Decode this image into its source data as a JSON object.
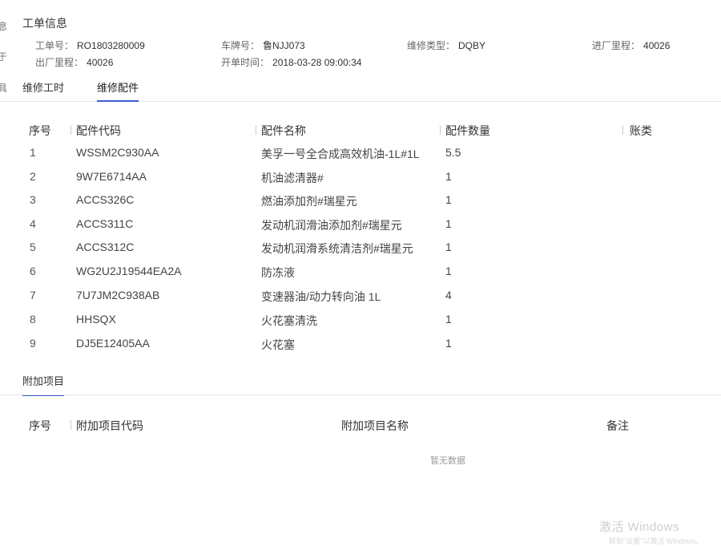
{
  "edge_glyphs": [
    "息",
    "于",
    "具"
  ],
  "info": {
    "section_title": "工单信息",
    "fields": [
      {
        "label": "工单号：",
        "value": "RO1803280009"
      },
      {
        "label": "车牌号：",
        "value": "鲁NJJ073"
      },
      {
        "label": "维修类型：",
        "value": "DQBY"
      },
      {
        "label": "进厂里程：",
        "value": "40026"
      },
      {
        "label": "出厂里程：",
        "value": "40026"
      },
      {
        "label": "开单时间：",
        "value": "2018-03-28 09:00:34"
      }
    ]
  },
  "tabs": [
    {
      "label": "维修工时",
      "active": false
    },
    {
      "label": "维修配件",
      "active": true
    }
  ],
  "parts_table": {
    "columns": [
      "序号",
      "配件代码",
      "配件名称",
      "配件数量",
      "账类"
    ],
    "rows": [
      [
        "1",
        "WSSM2C930AA",
        "美孚一号全合成高效机油-1L#1L",
        "5.5"
      ],
      [
        "2",
        "9W7E6714AA",
        "机油滤清器#",
        "1"
      ],
      [
        "3",
        "ACCS326C",
        "燃油添加剂#瑞星元",
        "1"
      ],
      [
        "4",
        "ACCS311C",
        "发动机润滑油添加剂#瑞星元",
        "1"
      ],
      [
        "5",
        "ACCS312C",
        "发动机润滑系统清洁剂#瑞星元",
        "1"
      ],
      [
        "6",
        "WG2U2J19544EA2A",
        "防冻液",
        "1"
      ],
      [
        "7",
        "7U7JM2C938AB",
        "变速器油/动力转向油 1L",
        "4"
      ],
      [
        "8",
        "HHSQX",
        "火花塞清洗",
        "1"
      ],
      [
        "9",
        "DJ5E12405AA",
        "火花塞",
        "1"
      ]
    ]
  },
  "extra": {
    "title": "附加项目",
    "columns": [
      "序号",
      "附加项目代码",
      "附加项目名称",
      "备注"
    ],
    "empty_text": "暂无数据"
  },
  "watermark": {
    "line1": "激活 Windows",
    "line2": "转到\"设置\"以激活 Windows。"
  },
  "colors": {
    "accent": "#3a5ccf",
    "border": "#e6e6e6"
  }
}
